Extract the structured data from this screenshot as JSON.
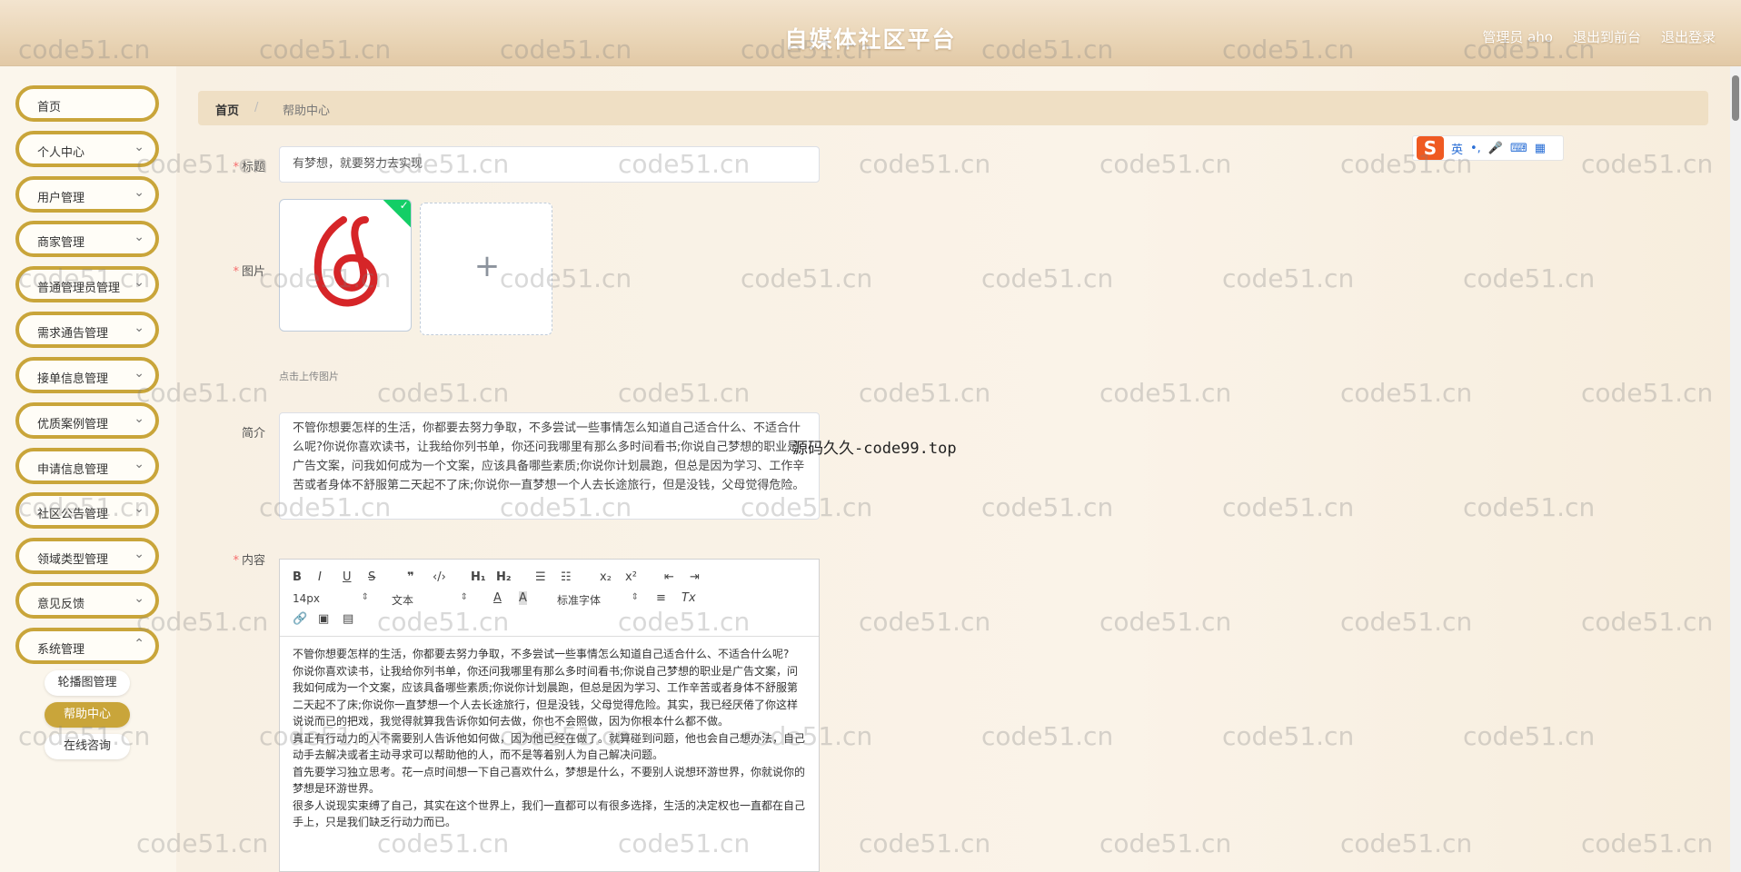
{
  "header": {
    "title": "自媒体社区平台",
    "user": "管理员 aho",
    "front_link": "退出到前台",
    "logout_link": "退出登录"
  },
  "sidebar": {
    "items": [
      {
        "label": "首页",
        "has_arrow": false
      },
      {
        "label": "个人中心",
        "has_arrow": true
      },
      {
        "label": "用户管理",
        "has_arrow": true
      },
      {
        "label": "商家管理",
        "has_arrow": true
      },
      {
        "label": "普通管理员管理",
        "has_arrow": true
      },
      {
        "label": "需求通告管理",
        "has_arrow": true
      },
      {
        "label": "接单信息管理",
        "has_arrow": true
      },
      {
        "label": "优质案例管理",
        "has_arrow": true
      },
      {
        "label": "申请信息管理",
        "has_arrow": true
      },
      {
        "label": "社区公告管理",
        "has_arrow": true
      },
      {
        "label": "领域类型管理",
        "has_arrow": true
      },
      {
        "label": "意见反馈",
        "has_arrow": true
      },
      {
        "label": "系统管理",
        "has_arrow": true
      }
    ],
    "sub_items": [
      {
        "label": "轮播图管理",
        "active": false
      },
      {
        "label": "帮助中心",
        "active": true
      },
      {
        "label": "在线咨询",
        "active": false
      }
    ],
    "accent_color": "#c9a53a"
  },
  "breadcrumb": {
    "home": "首页",
    "separator": "/",
    "current": "帮助中心"
  },
  "form": {
    "title_label": "标题",
    "title_value": "有梦想，就要努力去实现",
    "image_label": "图片",
    "upload_tip": "点击上传图片",
    "intro_label": "简介",
    "intro_value": "不管你想要怎样的生活，你都要去努力争取，不多尝试一些事情怎么知道自己适合什么、不适合什么呢?你说你喜欢读书，让我给你列书单，你还问我哪里有那么多时间看书;你说自己梦想的职业是广告文案，问我如何成为一个文案，应该具备哪些素质;你说你计划晨跑，但总是因为学习、工作辛苦或者身体不舒服第二天起不了床;你说你一直梦想一个人去长途旅行，但是没钱，父母觉得危险。",
    "content_label": "内容",
    "required_mark": "*"
  },
  "editor": {
    "font_size": "14px",
    "text_type": "文本",
    "font_family": "标准字体",
    "content_lines": [
      "不管你想要怎样的生活，你都要去努力争取，不多尝试一些事情怎么知道自己适合什么、不适合什么呢?",
      "你说你喜欢读书，让我给你列书单，你还问我哪里有那么多时间看书;你说自己梦想的职业是广告文案，问我如何成为一个文案，应该具备哪些素质;你说你计划晨跑，但总是因为学习、工作辛苦或者身体不舒服第二天起不了床;你说你一直梦想一个人去长途旅行，但是没钱，父母觉得危险。其实，我已经厌倦了你这样说说而已的把戏，我觉得就算我告诉你如何去做，你也不会照做，因为你根本什么都不做。",
      "真正有行动力的人不需要别人告诉他如何做，因为他已经在做了。就算碰到问题，他也会自己想办法，自己动手去解决或者主动寻求可以帮助他的人，而不是等着别人为自己解决问题。",
      "首先要学习独立思考。花一点时间想一下自己喜欢什么，梦想是什么，不要别人说想环游世界，你就说你的梦想是环游世界。",
      "很多人说现实束缚了自己，其实在这个世界上，我们一直都可以有很多选择，生活的决定权也一直都在自己手上，只是我们缺乏行动力而已。"
    ]
  },
  "ime": {
    "logo": "S",
    "lang": "英"
  },
  "overlay_text": "源码久久-code99.top",
  "watermark": "code51.cn"
}
